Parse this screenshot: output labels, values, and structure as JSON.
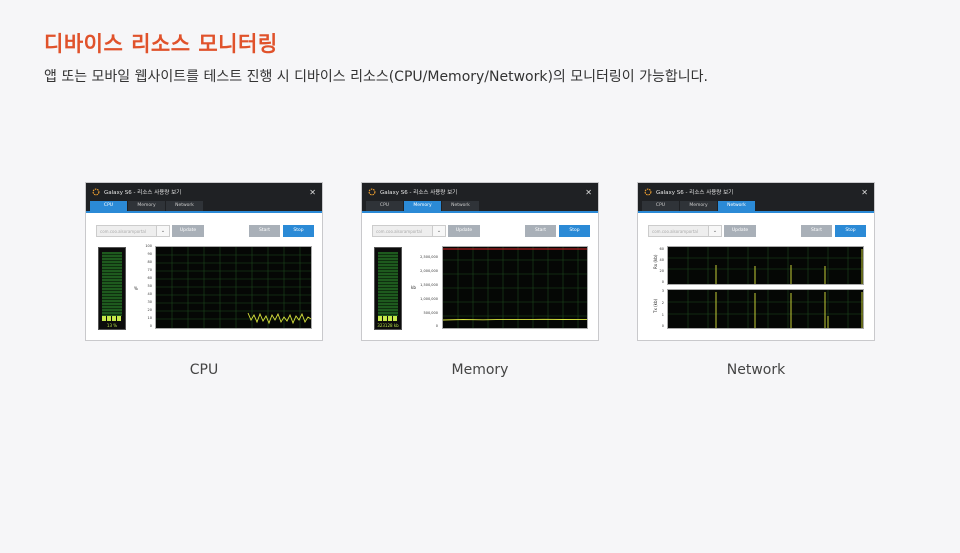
{
  "header": {
    "title": "디바이스 리소스 모니터링",
    "description": "앱 또는 모바일 웹사이트를 테스트 진행 시 디바이스 리소스(CPU/Memory/Network)의 모니터링이  가능합니다."
  },
  "colors": {
    "accent": "#e0522b",
    "primary_button": "#2b8ad6",
    "grid": "#1f4a1f",
    "trace": "#d8e33c",
    "limit_line": "#d22222"
  },
  "window": {
    "title": "Galaxy S6 - 리소스 사용량 보기",
    "tabs": [
      "CPU",
      "Memory",
      "Network"
    ],
    "combo_placeholder": "com.coo.alsoramportal",
    "update_label": "Update",
    "start_label": "Start",
    "stop_label": "Stop",
    "close_icon": "close-icon",
    "logo_icon": "app-logo-icon"
  },
  "cards": [
    {
      "caption": "CPU",
      "active_tab": 0,
      "gauge_label": "13 %",
      "y_unit": "%",
      "y_ticks": [
        "100",
        "90",
        "80",
        "70",
        "60",
        "50",
        "40",
        "30",
        "20",
        "10",
        "0"
      ]
    },
    {
      "caption": "Memory",
      "active_tab": 1,
      "gauge_label": "323128 kb",
      "y_unit": "kb",
      "y_ticks": [
        "2,500,000",
        "2,000,000",
        "1,500,000",
        "1,000,000",
        "500,000",
        "0"
      ]
    },
    {
      "caption": "Network",
      "active_tab": 2,
      "rx_unit": "Rx (kb)",
      "rx_ticks": [
        "60",
        "40",
        "20",
        "0"
      ],
      "tx_unit": "Tx (kb)",
      "tx_ticks": [
        "3",
        "2",
        "1",
        "0"
      ]
    }
  ]
}
